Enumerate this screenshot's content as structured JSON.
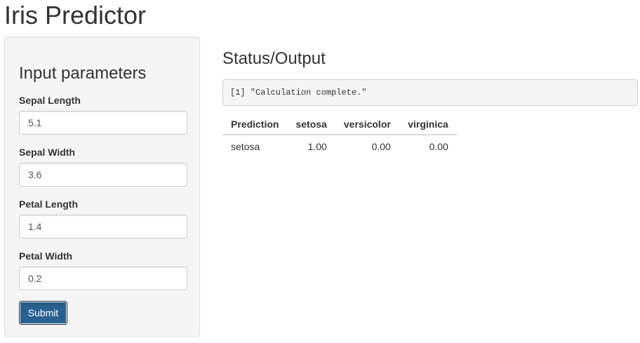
{
  "app": {
    "title": "Iris Predictor"
  },
  "sidebar": {
    "heading": "Input parameters",
    "fields": [
      {
        "label": "Sepal Length",
        "value": "5.1"
      },
      {
        "label": "Sepal Width",
        "value": "3.6"
      },
      {
        "label": "Petal Length",
        "value": "1.4"
      },
      {
        "label": "Petal Width",
        "value": "0.2"
      }
    ],
    "submit_label": "Submit"
  },
  "main": {
    "heading": "Status/Output",
    "status_text": "[1] \"Calculation complete.\"",
    "table": {
      "headers": [
        "Prediction",
        "setosa",
        "versicolor",
        "virginica"
      ],
      "rows": [
        [
          "setosa",
          "1.00",
          "0.00",
          "0.00"
        ]
      ]
    }
  },
  "colors": {
    "primary_button": "#286090",
    "panel_background": "#f5f5f5"
  }
}
